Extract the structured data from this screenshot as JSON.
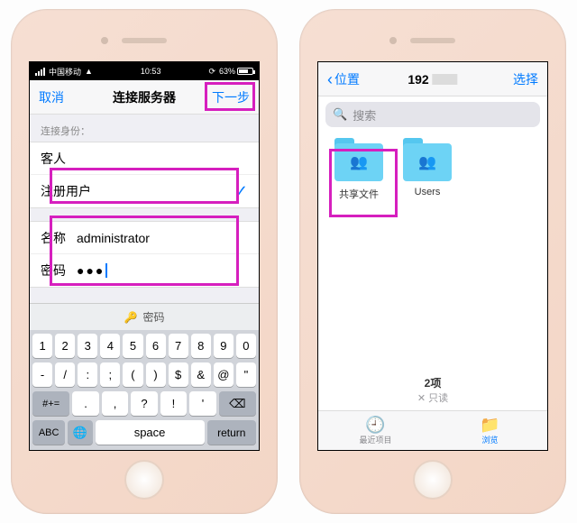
{
  "left": {
    "status": {
      "carrier": "中国移动",
      "wifi": "􀙇",
      "time": "10:53",
      "battery_pct": "63%",
      "battery_fill_pct": 63
    },
    "nav": {
      "cancel": "取消",
      "title": "连接服务器",
      "next": "下一步"
    },
    "identity_label": "连接身份：",
    "identity_options": {
      "guest": "客人",
      "registered": "注册用户"
    },
    "credentials": {
      "name_label": "名称",
      "name_value": "administrator",
      "password_label": "密码",
      "password_masked": "●●●"
    },
    "keyboard": {
      "hint": "密码",
      "row1": [
        "1",
        "2",
        "3",
        "4",
        "5",
        "6",
        "7",
        "8",
        "9",
        "0"
      ],
      "row2": [
        "-",
        "/",
        ":",
        ";",
        "(",
        ")",
        "$",
        "&",
        "@",
        "\""
      ],
      "row3_shift": "#+=",
      "row3": [
        ".",
        ",",
        "?",
        "!",
        "'"
      ],
      "row3_bksp": "⌫",
      "abc": "ABC",
      "globe": "🌐",
      "space": "space",
      "return": "return"
    }
  },
  "right": {
    "nav": {
      "back": "位置",
      "title_ip_prefix": "192",
      "select": "选择"
    },
    "search_placeholder": "搜索",
    "folders": [
      {
        "key": "shared",
        "label": "共享文件"
      },
      {
        "key": "users",
        "label": "Users"
      }
    ],
    "footer": {
      "count": "2项",
      "readonly": "✕ 只读"
    },
    "tabs": {
      "recent": "最近项目",
      "browse": "浏览"
    }
  }
}
